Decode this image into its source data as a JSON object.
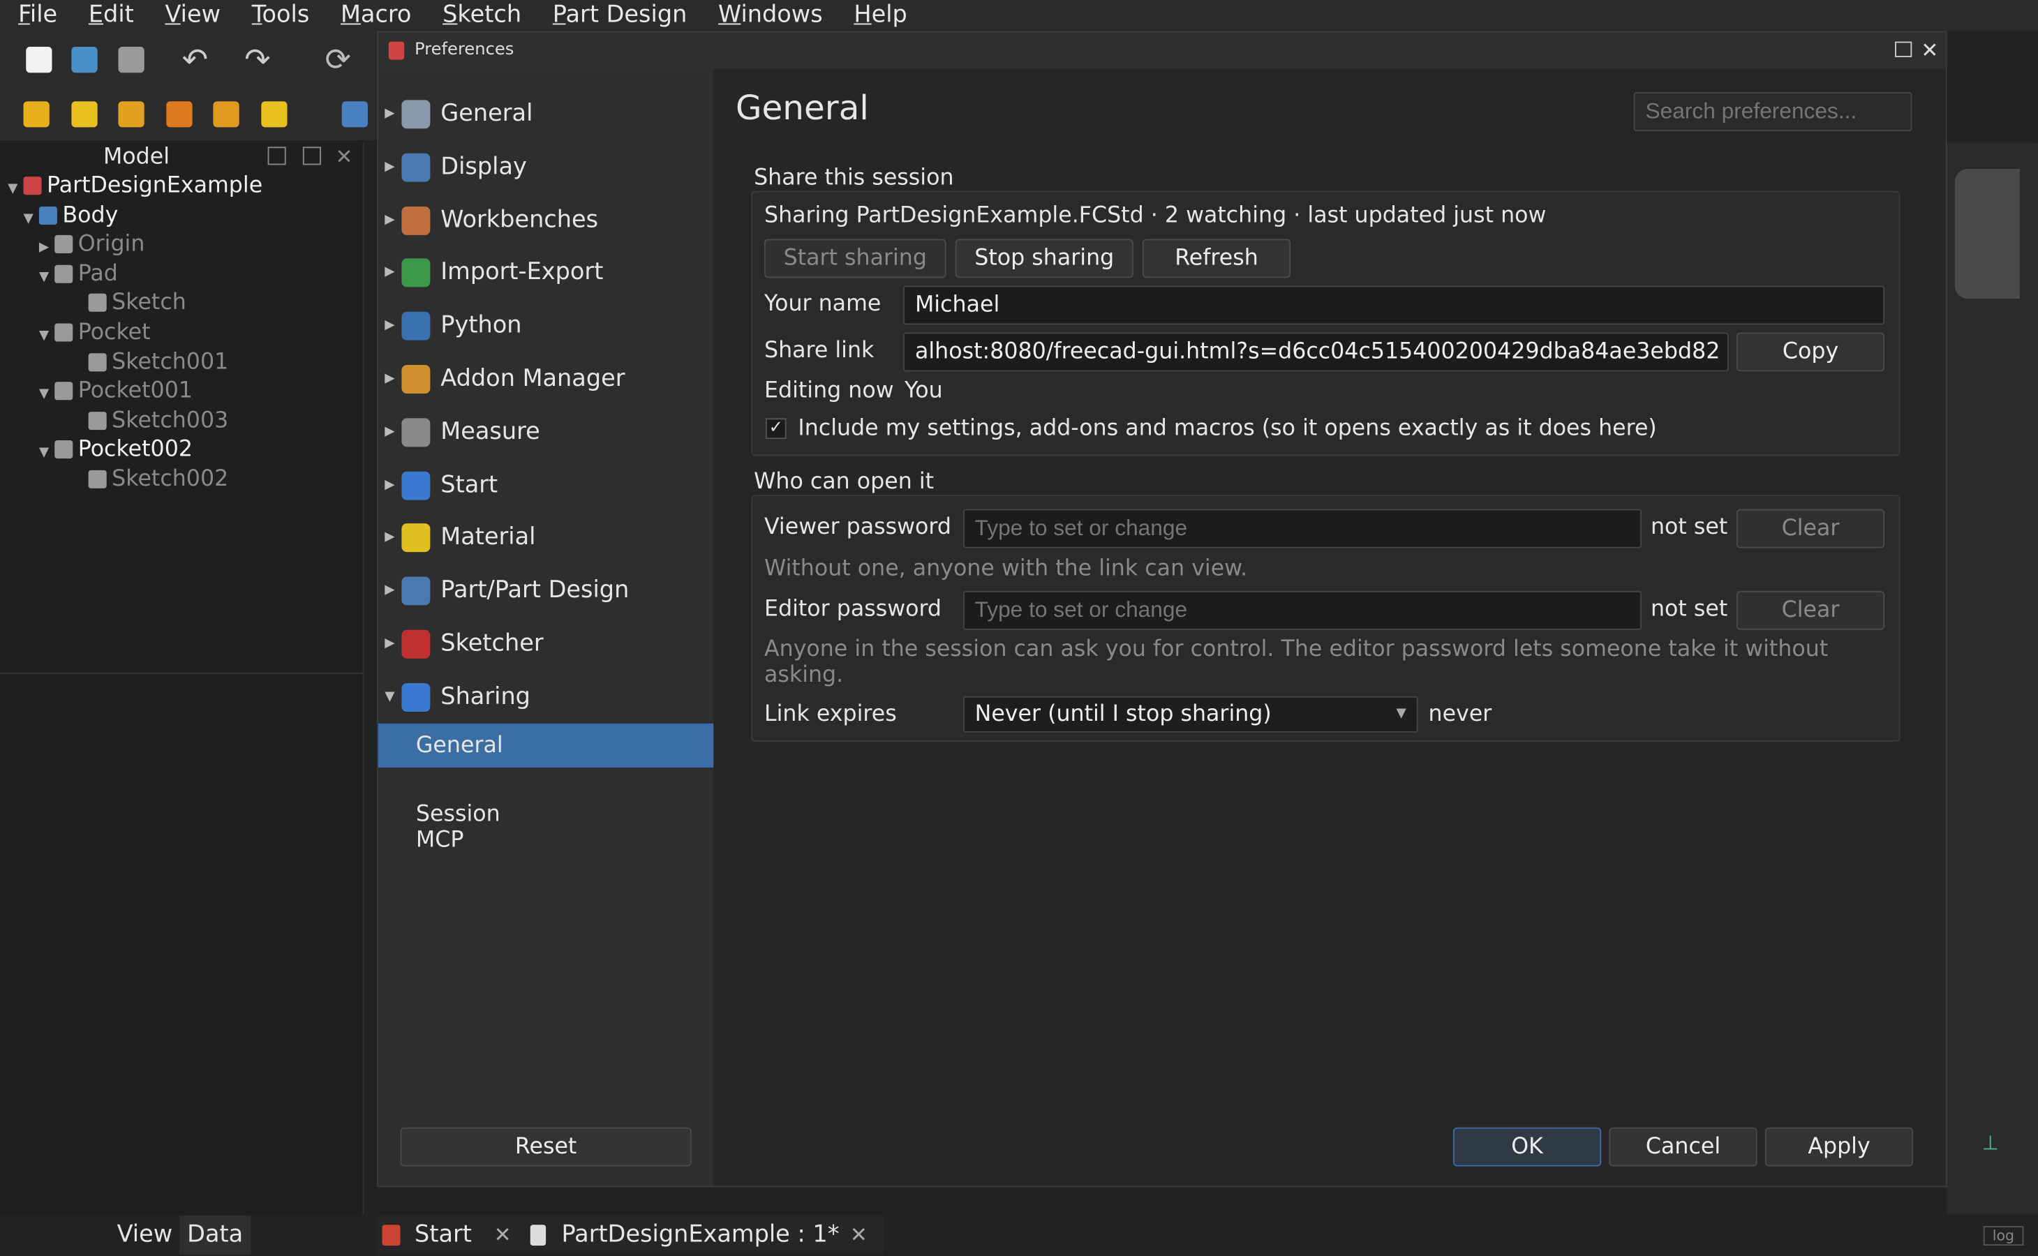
{
  "menubar": [
    "File",
    "Edit",
    "View",
    "Tools",
    "Macro",
    "Sketch",
    "Part Design",
    "Windows",
    "Help"
  ],
  "model_panel": {
    "title": "Model",
    "tree": [
      {
        "label": "PartDesignExample",
        "level": 0,
        "expanded": true,
        "active": true
      },
      {
        "label": "Body",
        "level": 1,
        "expanded": true,
        "active": true
      },
      {
        "label": "Origin",
        "level": 2,
        "expanded": false,
        "active": false
      },
      {
        "label": "Pad",
        "level": 2,
        "expanded": true,
        "active": false
      },
      {
        "label": "Sketch",
        "level": 3,
        "active": false
      },
      {
        "label": "Pocket",
        "level": 2,
        "expanded": true,
        "active": false
      },
      {
        "label": "Sketch001",
        "level": 3,
        "active": false
      },
      {
        "label": "Pocket001",
        "level": 2,
        "expanded": true,
        "active": false
      },
      {
        "label": "Sketch003",
        "level": 3,
        "active": false
      },
      {
        "label": "Pocket002",
        "level": 2,
        "expanded": true,
        "active": true
      },
      {
        "label": "Sketch002",
        "level": 3,
        "active": false
      }
    ],
    "tabs": [
      "View",
      "Data"
    ]
  },
  "dialog": {
    "title": "Preferences",
    "nav": [
      "General",
      "Display",
      "Workbenches",
      "Import-Export",
      "Python",
      "Addon Manager",
      "Measure",
      "Start",
      "Material",
      "Part/Part Design",
      "Sketcher",
      "Sharing"
    ],
    "nav_sub": [
      "General",
      "Session",
      "MCP"
    ],
    "reset_label": "Reset",
    "page_title": "General",
    "search_placeholder": "Search preferences...",
    "share": {
      "heading": "Share this session",
      "status": "Sharing PartDesignExample.FCStd · 2 watching · last updated just now",
      "start_label": "Start sharing",
      "stop_label": "Stop sharing",
      "refresh_label": "Refresh",
      "name_label": "Your name",
      "name_value": "Michael",
      "link_label": "Share link",
      "link_value": "alhost:8080/freecad-gui.html?s=d6cc04c515400200429dba84ae3ebd82",
      "copy_label": "Copy",
      "editing_label": "Editing now",
      "editing_value": "You",
      "include_label": "Include my settings, add-ons and macros (so it opens exactly as it does here)"
    },
    "access": {
      "heading": "Who can open it",
      "viewer_label": "Viewer password",
      "viewer_placeholder": "Type to set or change",
      "viewer_state": "not set",
      "viewer_clear": "Clear",
      "viewer_hint": "Without one, anyone with the link can view.",
      "editor_label": "Editor password",
      "editor_placeholder": "Type to set or change",
      "editor_state": "not set",
      "editor_clear": "Clear",
      "editor_hint": "Anyone in the session can ask you for control. The editor password lets someone take it without asking.",
      "expires_label": "Link expires",
      "expires_value": "Never (until I stop sharing)",
      "expires_state": "never"
    },
    "ok_label": "OK",
    "cancel_label": "Cancel",
    "apply_label": "Apply"
  },
  "doc_tabs": [
    "Start",
    "PartDesignExample : 1*"
  ],
  "status_log": "log",
  "colors": {
    "accent": "#3a6ea5",
    "bg": "#262626"
  }
}
